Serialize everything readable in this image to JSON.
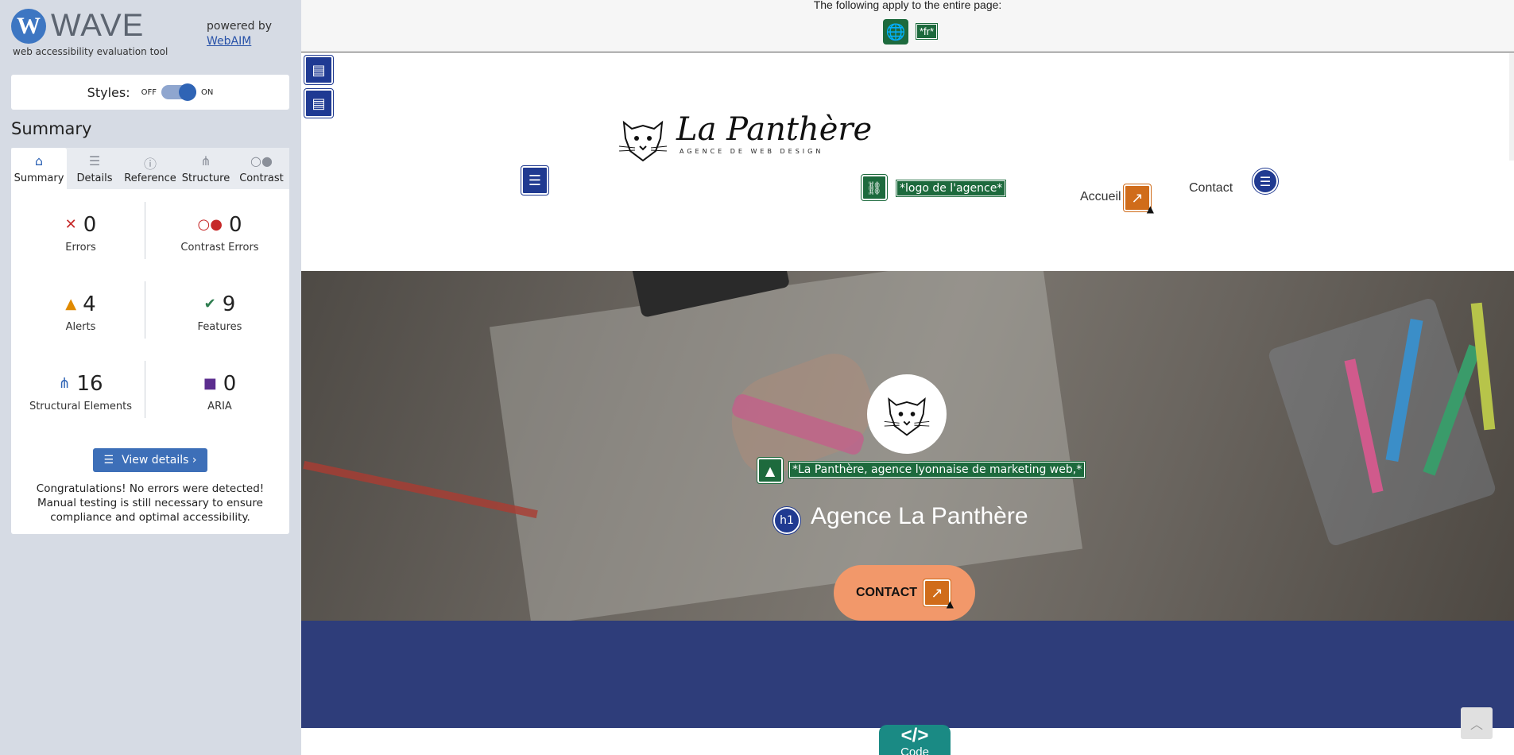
{
  "wave": {
    "logo_letter": "W",
    "logo_word": "WAVE",
    "tagline": "web accessibility evaluation tool",
    "powered_by": "powered by",
    "webaim_link": "WebAIM"
  },
  "styles": {
    "label": "Styles:",
    "off": "OFF",
    "on": "ON",
    "enabled": true
  },
  "summary_heading": "Summary",
  "tabs": [
    {
      "label": "Summary",
      "icon": "home-icon",
      "glyph": "⌂",
      "active": true
    },
    {
      "label": "Details",
      "icon": "list-icon",
      "glyph": "☰",
      "active": false
    },
    {
      "label": "Reference",
      "icon": "info-icon",
      "glyph": "ⓘ",
      "active": false
    },
    {
      "label": "Structure",
      "icon": "structure-icon",
      "glyph": "⋔",
      "active": false
    },
    {
      "label": "Contrast",
      "icon": "contrast-icon",
      "glyph": "○●",
      "active": false
    }
  ],
  "stats": {
    "errors": {
      "count": "0",
      "label": "Errors",
      "glyph": "✕",
      "color": "#c62828"
    },
    "contrast_errors": {
      "count": "0",
      "label": "Contrast Errors",
      "glyph": "○●",
      "color": "#c62828"
    },
    "alerts": {
      "count": "4",
      "label": "Alerts",
      "glyph": "▲",
      "color": "#e08a00"
    },
    "features": {
      "count": "9",
      "label": "Features",
      "glyph": "✔",
      "color": "#2e7d4f"
    },
    "structural": {
      "count": "16",
      "label": "Structural Elements",
      "glyph": "⋔",
      "color": "#2f64b5"
    },
    "aria": {
      "count": "0",
      "label": "ARIA",
      "glyph": "■",
      "color": "#5b2d8e"
    }
  },
  "view_details": "View details ›",
  "congrats": "Congratulations! No errors were detected! Manual testing is still necessary to ensure compliance and optimal accessibility.",
  "page_note": {
    "text": "The following apply to the entire page:",
    "lang_tag": "*fr*"
  },
  "site": {
    "brand": "La Panthère",
    "brand_sub": "AGENCE DE WEB DESIGN",
    "logo_alt": "*logo de l'agence*",
    "nav": [
      "Accueil",
      "Contact"
    ],
    "hero_alt": "*La Panthère, agence lyonnaise de marketing web,*",
    "h1_badge": "h1",
    "hero_title": "Agence La Panthère",
    "cta": "CONTACT"
  },
  "code_tab": {
    "brackets": "</>",
    "label": "Code"
  },
  "colors": {
    "wave_blue": "#3d76c2",
    "feature_green": "#1d6a3d",
    "alert_orange": "#d06c1a",
    "structure_navy": "#203a91",
    "cta_orange": "#f2986a",
    "band_navy": "#2e3d7a"
  }
}
